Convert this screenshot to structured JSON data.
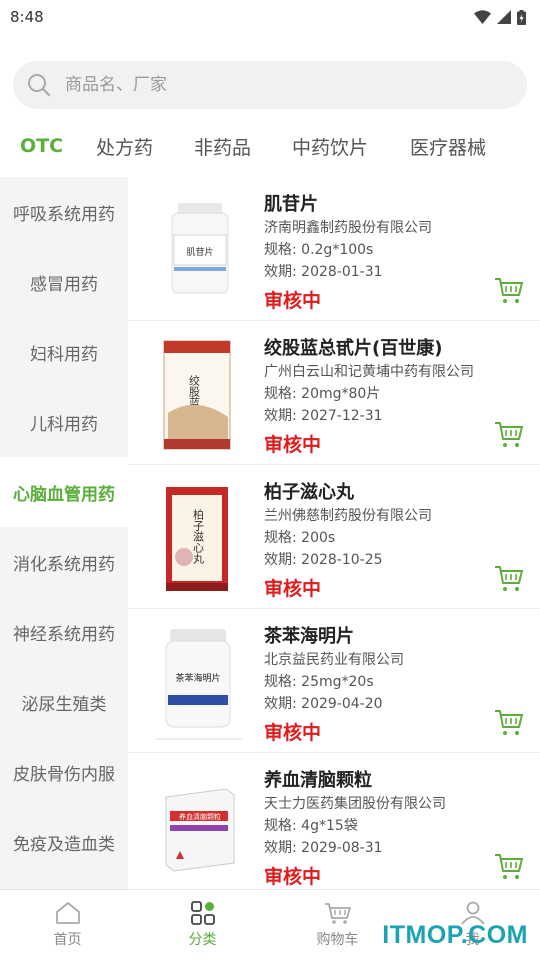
{
  "status_bar": {
    "time": "8:48"
  },
  "search": {
    "placeholder": "商品名、厂家"
  },
  "tabs": [
    {
      "label": "OTC",
      "active": true
    },
    {
      "label": "处方药",
      "active": false
    },
    {
      "label": "非药品",
      "active": false
    },
    {
      "label": "中药饮片",
      "active": false
    },
    {
      "label": "医疗器械",
      "active": false
    }
  ],
  "sidebar": [
    {
      "label": "呼吸系统用药",
      "active": false
    },
    {
      "label": "感冒用药",
      "active": false
    },
    {
      "label": "妇科用药",
      "active": false
    },
    {
      "label": "儿科用药",
      "active": false
    },
    {
      "label": "心脑血管用药",
      "active": true
    },
    {
      "label": "消化系统用药",
      "active": false
    },
    {
      "label": "神经系统用药",
      "active": false
    },
    {
      "label": "泌尿生殖类",
      "active": false
    },
    {
      "label": "皮肤骨伤内服",
      "active": false
    },
    {
      "label": "免疫及造血类",
      "active": false
    }
  ],
  "products": [
    {
      "name": "肌苷片",
      "maker": "济南明鑫制药股份有限公司",
      "spec": "规格: 0.2g*100s",
      "expiry": "效期: 2028-01-31",
      "status": "审核中",
      "pack_text": "肌苷片"
    },
    {
      "name": "绞股蓝总甙片(百世康)",
      "maker": "广州白云山和记黄埔中药有限公司",
      "spec": "规格: 20mg*80片",
      "expiry": "效期: 2027-12-31",
      "status": "审核中",
      "pack_text": "绞股蓝总甙片"
    },
    {
      "name": "柏子滋心丸",
      "maker": "兰州佛慈制药股份有限公司",
      "spec": "规格: 200s",
      "expiry": "效期: 2028-10-25",
      "status": "审核中",
      "pack_text": "柏子滋心丸"
    },
    {
      "name": "茶苯海明片",
      "maker": "北京益民药业有限公司",
      "spec": "规格: 25mg*20s",
      "expiry": "效期: 2029-04-20",
      "status": "审核中",
      "pack_text": "茶苯海明片"
    },
    {
      "name": "养血清脑颗粒",
      "maker": "天士力医药集团股份有限公司",
      "spec": "规格: 4g*15袋",
      "expiry": "效期: 2029-08-31",
      "status": "审核中",
      "pack_text": "养血清脑颗粒"
    }
  ],
  "bottom_nav": [
    {
      "label": "首页",
      "icon": "home-icon",
      "active": false
    },
    {
      "label": "分类",
      "icon": "category-icon",
      "active": true
    },
    {
      "label": "购物车",
      "icon": "cart-icon",
      "active": false
    },
    {
      "label": "我",
      "icon": "user-icon",
      "active": false
    }
  ],
  "watermark": "ITMOP.COM",
  "colors": {
    "accent": "#5aae3a",
    "status_red": "#e01b1b",
    "sidebar_bg": "#f4f4f4"
  }
}
